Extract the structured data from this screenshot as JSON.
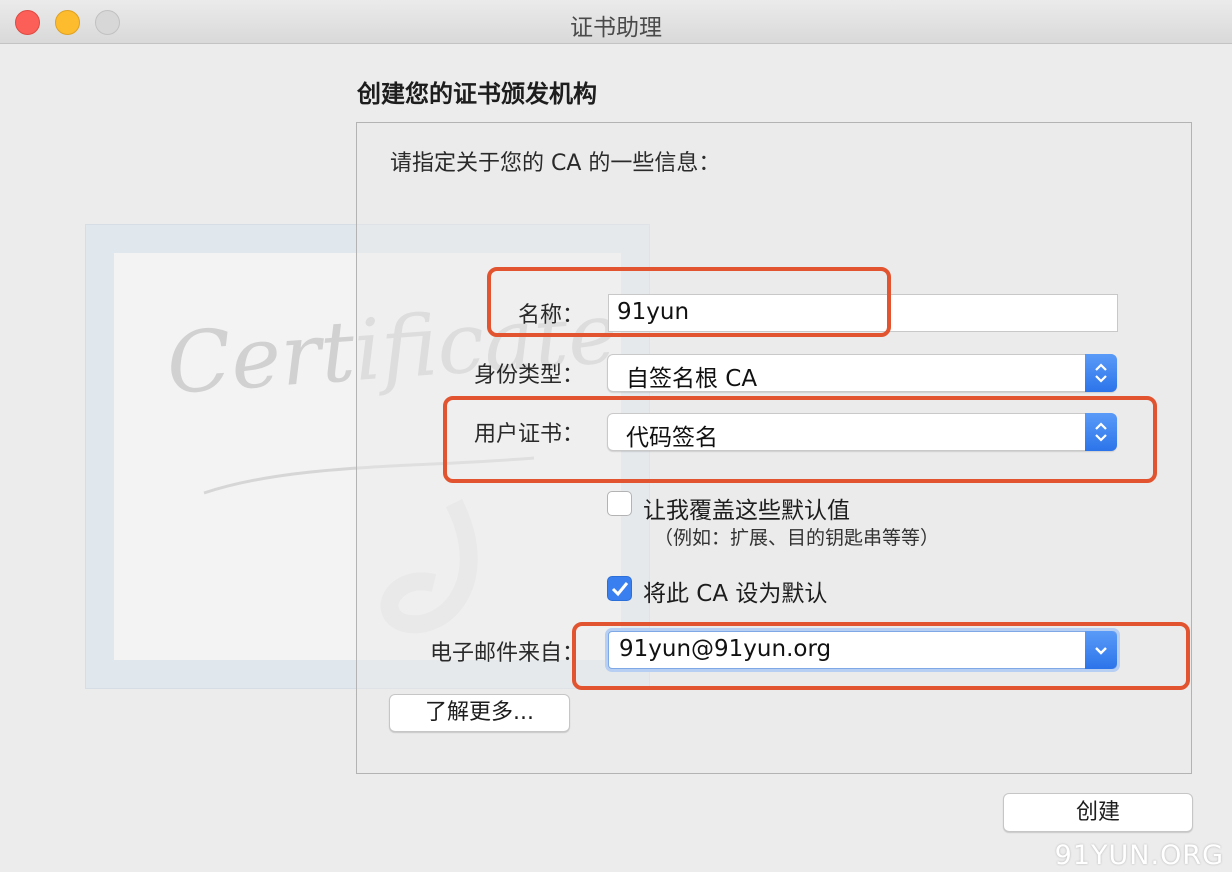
{
  "window": {
    "title": "证书助理"
  },
  "page": {
    "heading": "创建您的证书颁发机构",
    "intro": "请指定关于您的 CA 的一些信息："
  },
  "form": {
    "name_label": "名称：",
    "name_value": "91yun",
    "identity_label": "身份类型：",
    "identity_value": "自签名根 CA",
    "user_cert_label": "用户证书：",
    "user_cert_value": "代码签名",
    "override_label": "让我覆盖这些默认值",
    "override_hint": "（例如：扩展、目的钥匙串等等）",
    "override_checked": false,
    "default_label": "将此 CA 设为默认",
    "default_checked": true,
    "email_label": "电子邮件来自：",
    "email_value": "91yun@91yun.org"
  },
  "buttons": {
    "learn_more": "了解更多...",
    "create": "创建"
  },
  "watermark": "91YUN.ORG",
  "colors": {
    "accent": "#3a7ff0",
    "annotation": "#e2542f"
  }
}
